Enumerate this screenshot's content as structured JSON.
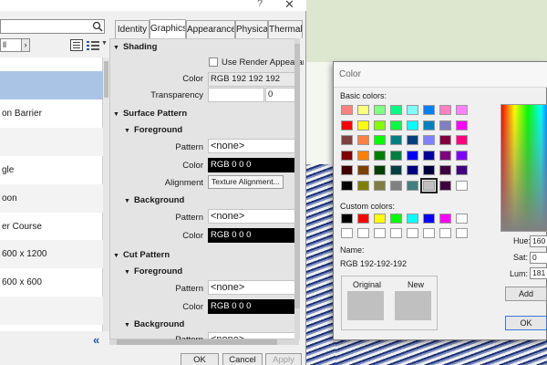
{
  "main_dialog": {
    "title_help": "?",
    "title_close": "✕",
    "filter_value": "ll",
    "materials": [
      "",
      "on Barrier",
      "",
      "gle",
      "oon",
      "er Course",
      "600 x 1200",
      "600 x 600",
      ""
    ],
    "tabs": [
      "Identity",
      "Graphics",
      "Appearance",
      "Physical",
      "Thermal"
    ],
    "active_tab": "Graphics",
    "shading": {
      "header": "Shading",
      "use_render_label": "Use Render Appearance",
      "color_label": "Color",
      "color_value": "RGB 192 192 192",
      "transparency_label": "Transparency",
      "transparency_value": "0"
    },
    "surface_pattern": {
      "header": "Surface Pattern",
      "foreground": {
        "header": "Foreground",
        "pattern_label": "Pattern",
        "pattern_value": "<none>",
        "color_label": "Color",
        "color_value": "RGB 0 0 0",
        "alignment_label": "Alignment",
        "alignment_button": "Texture Alignment..."
      },
      "background": {
        "header": "Background",
        "pattern_label": "Pattern",
        "pattern_value": "<none>",
        "color_label": "Color",
        "color_value": "RGB 0 0 0"
      }
    },
    "cut_pattern": {
      "header": "Cut Pattern",
      "foreground": {
        "header": "Foreground",
        "pattern_label": "Pattern",
        "pattern_value": "<none>",
        "color_label": "Color",
        "color_value": "RGB 0 0 0"
      },
      "background": {
        "header": "Background",
        "pattern_label": "Pattern",
        "pattern_value": "<none>"
      }
    },
    "buttons": {
      "ok": "OK",
      "cancel": "Cancel",
      "apply": "Apply"
    }
  },
  "color_dialog": {
    "title": "Color",
    "basic_colors_label": "Basic colors:",
    "custom_colors_label": "Custom colors:",
    "name_label": "Name:",
    "name_value": "RGB 192-192-192",
    "original_label": "Original",
    "new_label": "New",
    "hue_label": "Hue:",
    "hue_value": "160",
    "sat_label": "Sat:",
    "sat_value": "0",
    "lum_label": "Lum:",
    "lum_value": "181",
    "add_button": "Add",
    "ok_button": "OK",
    "selected_color": "#c0c0c0",
    "basic_colors": [
      [
        "#ff8080",
        "#ffff80",
        "#80ff80",
        "#00ff80",
        "#80ffff",
        "#0080ff",
        "#ff80c0",
        "#ff80ff"
      ],
      [
        "#ff0000",
        "#ffff00",
        "#80ff00",
        "#00ff40",
        "#00ffff",
        "#0080c0",
        "#8080c0",
        "#ff00ff"
      ],
      [
        "#804040",
        "#ff8040",
        "#00ff00",
        "#008080",
        "#004080",
        "#8080ff",
        "#800040",
        "#ff0080"
      ],
      [
        "#800000",
        "#ff8000",
        "#008000",
        "#008040",
        "#0000ff",
        "#0000a0",
        "#800080",
        "#8000ff"
      ],
      [
        "#400000",
        "#804000",
        "#004000",
        "#004040",
        "#000080",
        "#000040",
        "#400040",
        "#400080"
      ],
      [
        "#000000",
        "#808000",
        "#808040",
        "#808080",
        "#408080",
        "#c0c0c0",
        "#400040",
        "#ffffff"
      ]
    ],
    "custom_colors": [
      [
        "#000000",
        "#ff0000",
        "#ffff00",
        "#00ff00",
        "#00ffff",
        "#0000ff",
        "#ff00ff",
        "#ffffff"
      ],
      [
        "#ffffff",
        "#ffffff",
        "#ffffff",
        "#ffffff",
        "#ffffff",
        "#ffffff",
        "#ffffff",
        "#ffffff"
      ]
    ]
  }
}
